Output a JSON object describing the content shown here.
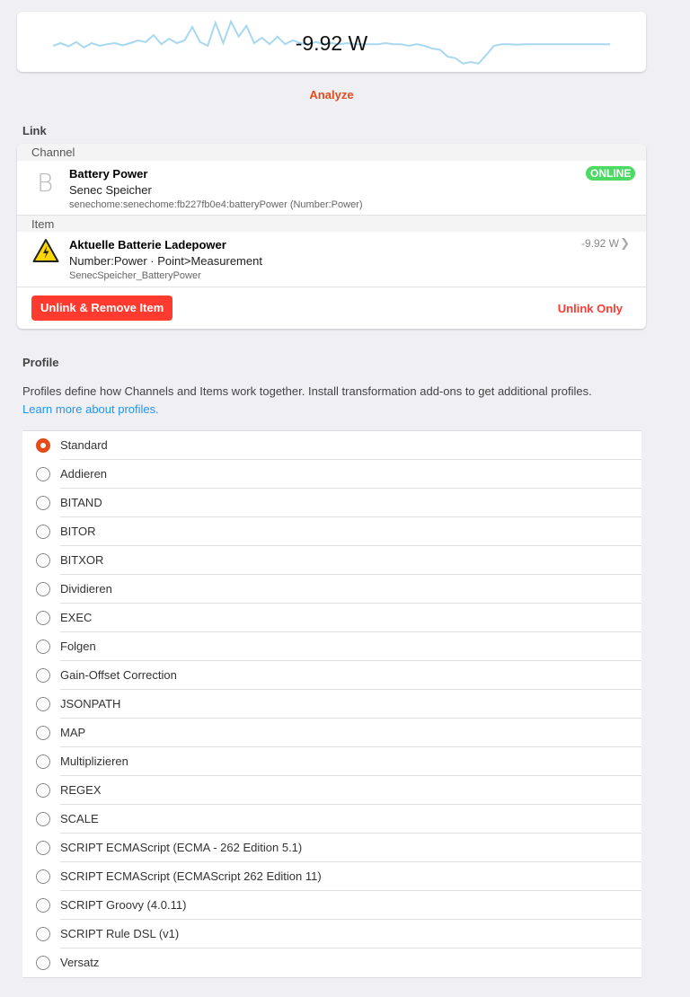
{
  "sparkline": {
    "value": "-9.92 W",
    "color": "#a8d8f0",
    "series": [
      0.55,
      0.5,
      0.56,
      0.48,
      0.58,
      0.5,
      0.55,
      0.52,
      0.5,
      0.54,
      0.5,
      0.45,
      0.48,
      0.35,
      0.52,
      0.42,
      0.5,
      0.45,
      0.2,
      0.48,
      0.55,
      0.12,
      0.5,
      0.1,
      0.38,
      0.18,
      0.5,
      0.4,
      0.52,
      0.38,
      0.52,
      0.45,
      0.5,
      0.52,
      0.48,
      0.52,
      0.5,
      0.52,
      0.5,
      0.52,
      0.52,
      0.52,
      0.52,
      0.5,
      0.52,
      0.52,
      0.55,
      0.52,
      0.55,
      0.6,
      0.62,
      0.75,
      0.78,
      0.88,
      0.85,
      0.88,
      0.72,
      0.55,
      0.52,
      0.52,
      0.53,
      0.52,
      0.52,
      0.52,
      0.52,
      0.52,
      0.52,
      0.52,
      0.52,
      0.52,
      0.52,
      0.52,
      0.52
    ]
  },
  "analyze_label": "Analyze",
  "link": {
    "title": "Link",
    "channel_header": "Channel",
    "channel_letter": "B",
    "channel_name": "Battery Power",
    "channel_thing": "Senec Speicher",
    "channel_uid": "senechome:senechome:fb227fb0e4:batteryPower (Number:Power)",
    "channel_status": "ONLINE",
    "status_color": "#4cd964",
    "item_header": "Item",
    "item_icon": "warning-icon",
    "item_label": "Aktuelle Batterie Ladepower",
    "item_type": "Number:Power · Point>Measurement",
    "item_name": "SenecSpeicher_BatteryPower",
    "item_state": "-9.92 W",
    "unlink_remove_label": "Unlink & Remove Item",
    "unlink_only_label": "Unlink Only"
  },
  "profile": {
    "title": "Profile",
    "description": "Profiles define how Channels and Items work together. Install transformation add-ons to get additional profiles.",
    "learn_more": "Learn more about profiles.",
    "accent": "#e64a19",
    "selected": "Standard",
    "options": [
      "Standard",
      "Addieren",
      "BITAND",
      "BITOR",
      "BITXOR",
      "Dividieren",
      "EXEC",
      "Folgen",
      "Gain-Offset Correction",
      "JSONPATH",
      "MAP",
      "Multiplizieren",
      "REGEX",
      "SCALE",
      "SCRIPT ECMAScript (ECMA - 262 Edition 5.1)",
      "SCRIPT ECMAScript (ECMAScript 262 Edition 11)",
      "SCRIPT Groovy (4.0.11)",
      "SCRIPT Rule DSL (v1)",
      "Versatz"
    ]
  }
}
